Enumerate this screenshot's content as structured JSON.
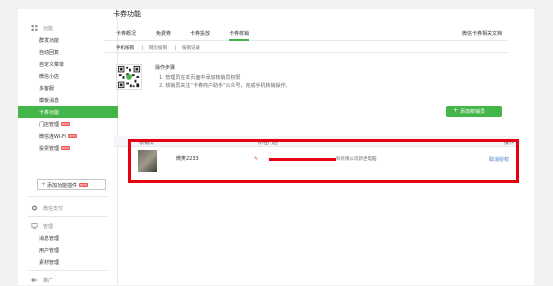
{
  "sidebar": {
    "function_group": "功能",
    "items": [
      {
        "label": "群发功能",
        "badge": ""
      },
      {
        "label": "自动回复",
        "badge": ""
      },
      {
        "label": "自定义菜单",
        "badge": ""
      },
      {
        "label": "微信小店",
        "badge": ""
      },
      {
        "label": "多客服",
        "badge": ""
      },
      {
        "label": "模板消息",
        "badge": ""
      },
      {
        "label": "卡券功能",
        "badge": ""
      },
      {
        "label": "门店管理",
        "badge": "NEW"
      },
      {
        "label": "微信连Wi-Fi",
        "badge": "NEW"
      },
      {
        "label": "投票管理",
        "badge": "NEW"
      }
    ],
    "add_plugin": "添加功能插件",
    "add_plugin_badge": "NEW",
    "wechat_pay": "微信支付",
    "manage_group": "管理",
    "manage_items": [
      "消息管理",
      "用户管理",
      "素材管理"
    ],
    "promote": "推广"
  },
  "main": {
    "title": "卡券功能",
    "tabs": [
      "卡券概况",
      "免费券",
      "卡券投放",
      "卡券核销"
    ],
    "doc_link": "微信卡券相关文档",
    "subtabs": [
      "手机核销",
      "网页核销",
      "核销记录"
    ],
    "steps_title": "操作步骤",
    "steps": [
      "1. 管理员在本页面中添加核销员权限",
      "2. 核销员关注“卡券商户助手”公众号，完成手机核销操作。"
    ],
    "add_button": "添加核销员",
    "table": {
      "headers": [
        "核销员",
        "所在门店",
        "操作"
      ],
      "rows": [
        {
          "name": "微笑2233",
          "store": "科有限公司新世电脑",
          "action": "取消授权"
        }
      ]
    }
  },
  "colors": {
    "accent": "#44b549",
    "highlight": "#e60012",
    "link": "#4a7ac4"
  }
}
